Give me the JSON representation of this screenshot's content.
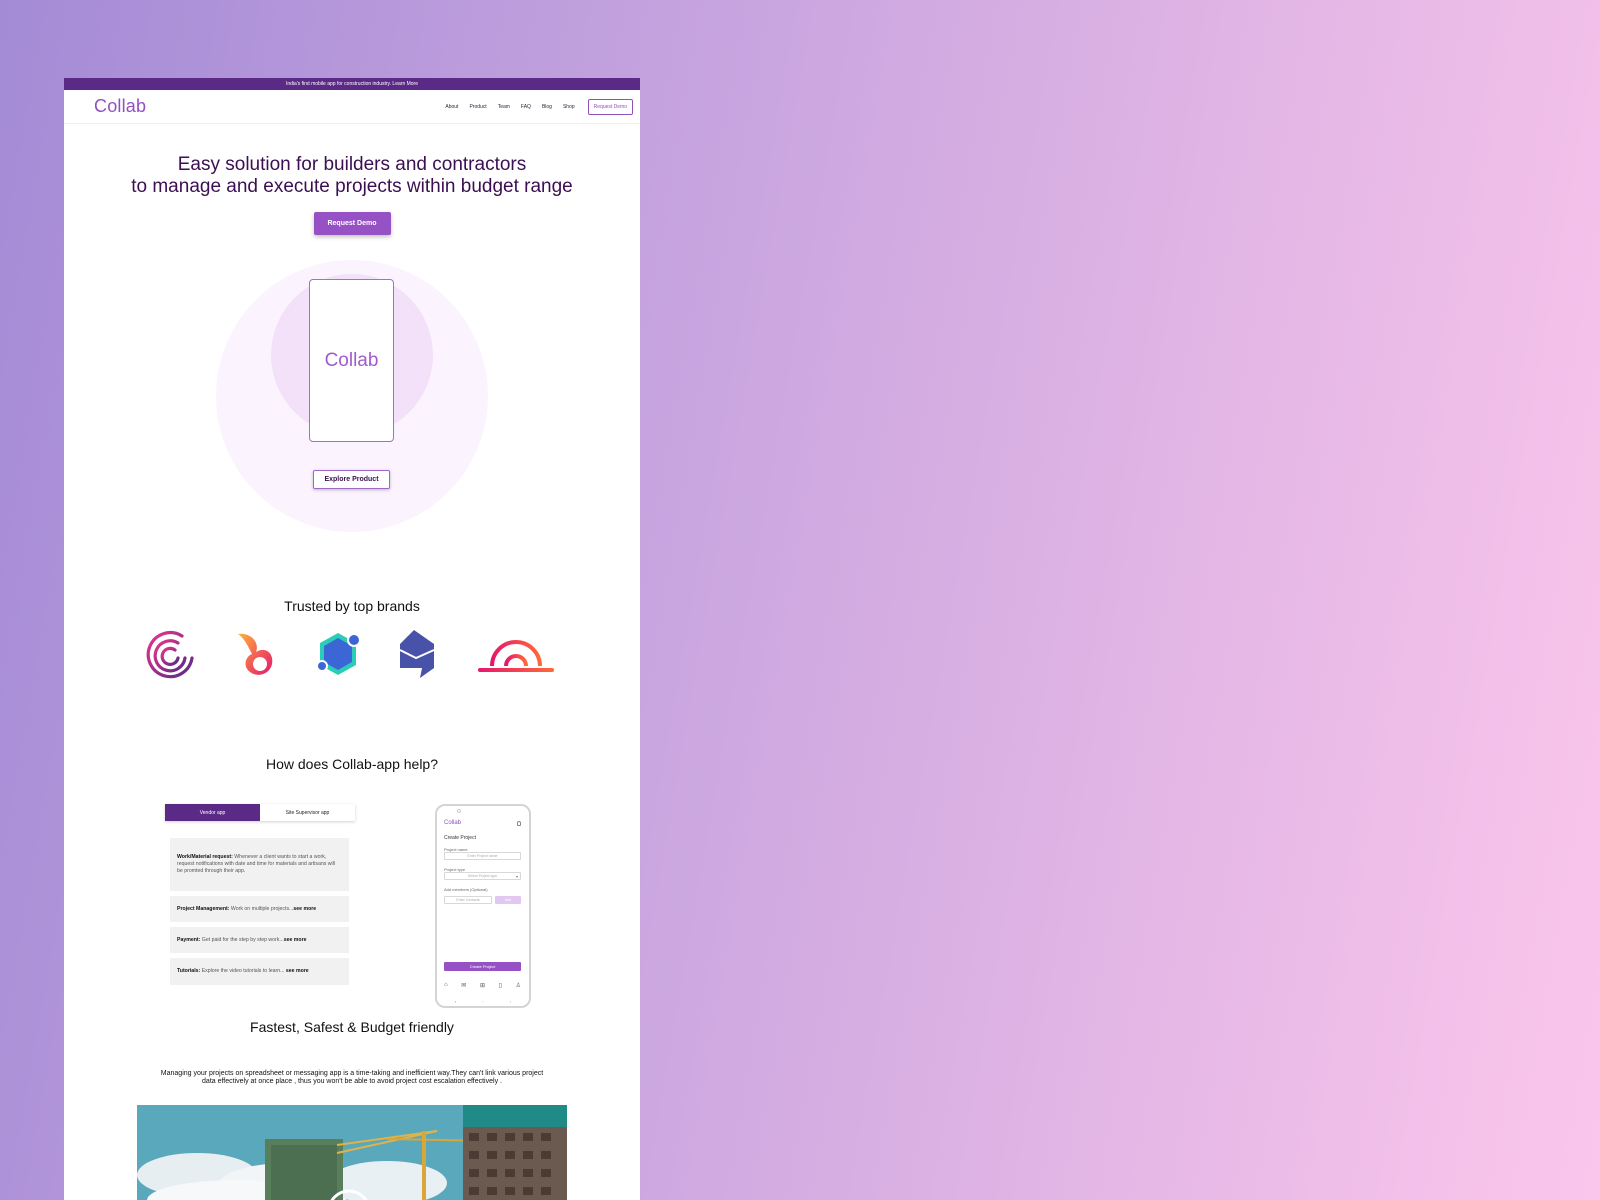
{
  "announcement": "India's first mobile app for construction industry. Learn More",
  "nav": {
    "logo": "Collab",
    "links": [
      "About",
      "Product",
      "Team",
      "FAQ",
      "Blog",
      "Shop"
    ],
    "cta": "Request Demo"
  },
  "hero": {
    "title_line1": "Easy solution for builders and contractors",
    "title_line2": "to manage and execute projects within budget range",
    "cta": "Request Demo",
    "phone_logo": "Collab",
    "secondary_cta": "Explore Product"
  },
  "trusted": {
    "title": "Trusted by top brands",
    "logos": [
      "spiral-logo",
      "flame-logo",
      "hexagon-logo",
      "house-logo",
      "arc-logo"
    ]
  },
  "how": {
    "title": "How does Collab-app help?",
    "tabs": [
      "Vendor app",
      "Site Supervisor app"
    ],
    "features": [
      {
        "title": "Work/Material request:",
        "text": " Whenever a client wants to start a work, request notifications with date and time for materials and artisans will be promted through their app."
      },
      {
        "title": "Project Management:",
        "text": " Work on multiple projects...",
        "more": "see more"
      },
      {
        "title": "Payment:",
        "text": " Get paid for the step by step work...",
        "more": "see more"
      },
      {
        "title": "Tutorials:",
        "text": " Explore the video tutorials to learn... ",
        "more": "see more"
      }
    ],
    "app": {
      "logo": "Collab",
      "heading": "Create Project",
      "name_label": "Project name",
      "name_placeholder": "Enter Project name",
      "type_label": "Project type",
      "type_placeholder": "Select Project type",
      "members_label": "Add members (Optional)",
      "members_placeholder": "Enter Contacts",
      "add_label": "Add",
      "create_button": "Create Project"
    }
  },
  "fast": {
    "title": "Fastest, Safest & Budget friendly",
    "paragraph": "Managing your projects on spreadsheet  or messaging app is a time-taking and inefficient way.They can't link various project data effectively at once place , thus you won't be able to avoid project cost escalation effectively ."
  },
  "colors": {
    "brand_purple": "#9150c0",
    "deep_purple": "#5b2a86",
    "heading": "#3b0f52"
  }
}
